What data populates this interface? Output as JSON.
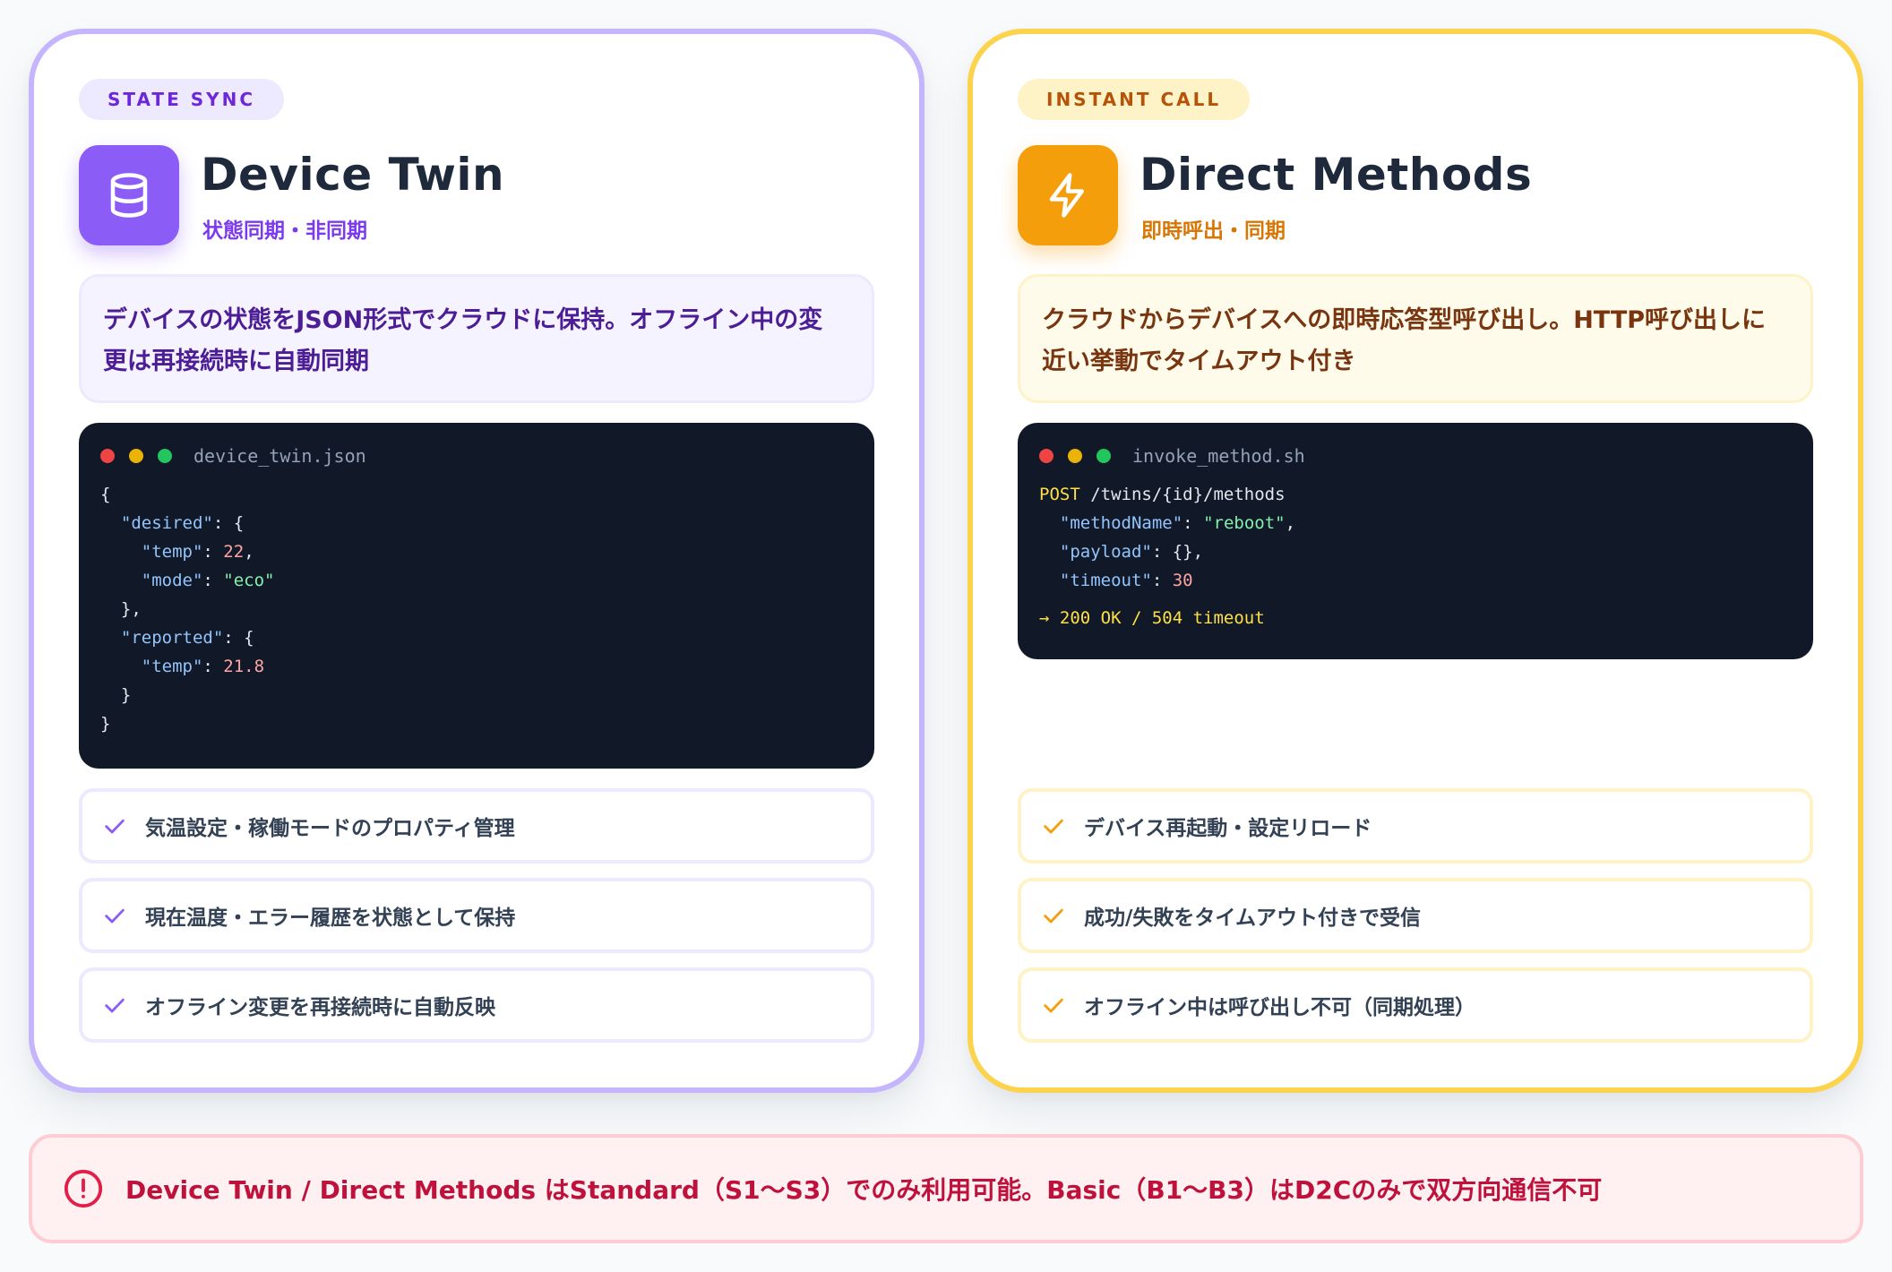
{
  "cards": {
    "twin": {
      "tag": "STATE SYNC",
      "icon": "database-icon",
      "title": "Device Twin",
      "subtitle": "状態同期・非同期",
      "desc_line1": "デバイスの状態をJSON形式でクラウドに保持。オフライン中の変",
      "desc_line2": "更は再接続時に自動同期",
      "code": {
        "filename": "device_twin.json",
        "lines": [
          "{",
          "\"desired\": {",
          "\"temp\": 22,",
          "\"mode\": \"eco\"",
          "},",
          "\"reported\": {",
          "\"temp\": 21.8",
          "}",
          "}"
        ],
        "tokens": {
          "desired": "\"desired\"",
          "temp": "\"temp\"",
          "mode": "\"mode\"",
          "eco": "\"eco\"",
          "reported": "\"reported\"",
          "v22": "22",
          "v218": "21.8"
        }
      },
      "features": [
        "気温設定・稼働モードのプロパティ管理",
        "現在温度・エラー履歴を状態として保持",
        "オフライン変更を再接続時に自動反映"
      ]
    },
    "methods": {
      "tag": "INSTANT CALL",
      "icon": "lightning-bolt-icon",
      "title": "Direct Methods",
      "subtitle": "即時呼出・同期",
      "desc_line1": "クラウドからデバイスへの即時応答型呼び出し。HTTP呼び出しに",
      "desc_line2": "近い挙動でタイムアウト付き",
      "code": {
        "filename": "invoke_method.sh",
        "verb": "POST",
        "path": "/twins/{id}/methods",
        "methodName_key": "\"methodName\"",
        "methodName_val": "\"reboot\"",
        "payload_key": "\"payload\"",
        "payload_val": "{}",
        "timeout_key": "\"timeout\"",
        "timeout_val": "30",
        "result": "→ 200 OK / 504 timeout"
      },
      "features": [
        "デバイス再起動・設定リロード",
        "成功/失敗をタイムアウト付きで受信",
        "オフライン中は呼び出し不可（同期処理）"
      ]
    }
  },
  "warning": {
    "icon": "alert-circle-icon",
    "text": "Device Twin / Direct Methods はStandard（S1〜S3）でのみ利用可能。Basic（B1〜B3）はD2Cのみで双方向通信不可"
  },
  "colors": {
    "twin_accent": "#8b5cf6",
    "methods_accent": "#f59e0b",
    "warning": "#be123c"
  }
}
